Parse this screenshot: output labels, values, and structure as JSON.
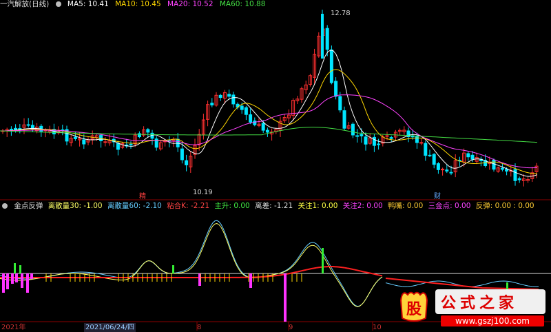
{
  "main_header": {
    "title": "一汽解放(日线)",
    "ma": [
      {
        "label": "MA5: 10.41",
        "color": "#ffffff"
      },
      {
        "label": "MA10: 10.45",
        "color": "#ffd700"
      },
      {
        "label": "MA20: 10.52",
        "color": "#ff44ff"
      },
      {
        "label": "MA60: 10.88",
        "color": "#44dd44"
      }
    ]
  },
  "indicator_header": {
    "name": "金点反弹",
    "items": [
      {
        "label": "离散量30: -1.00",
        "color": "#ffff66"
      },
      {
        "label": "离散量60: -2.10",
        "color": "#66ccff"
      },
      {
        "label": "粘合K: -2.21",
        "color": "#ff4444"
      },
      {
        "label": "主升: 0.00",
        "color": "#44ee44"
      },
      {
        "label": "离差: -1.21",
        "color": "#dddddd"
      },
      {
        "label": "关注1: 0.00",
        "color": "#ffff44"
      },
      {
        "label": "关注2: 0.00",
        "color": "#ff44ff"
      },
      {
        "label": "鸭嘴: 0.00",
        "color": "#ffcc33"
      },
      {
        "label": "三金点: 0.00",
        "color": "#ff44ff"
      },
      {
        "label": "反弹: 0.00 : 0.00",
        "color": "#ffcc33"
      }
    ]
  },
  "price_annotations": {
    "high": "12.78",
    "low": "10.19",
    "marker_jing": "精",
    "marker_cai": "财"
  },
  "x_axis": {
    "labels": [
      "2021年",
      "2021/06/24/四",
      "8",
      "9",
      "10"
    ]
  },
  "watermark": {
    "badge_char": "股",
    "title": "公式之家",
    "url": "www.gszj100.com"
  },
  "colors": {
    "up": "#ff3030",
    "down": "#00e5ff",
    "ma5": "#ffffff",
    "ma10": "#ffd700",
    "ma20": "#ff44ff",
    "ma60": "#44dd44",
    "line_red": "#ff2020",
    "line_cyan": "#66ccff",
    "line_yellow": "#ffff66"
  }
}
